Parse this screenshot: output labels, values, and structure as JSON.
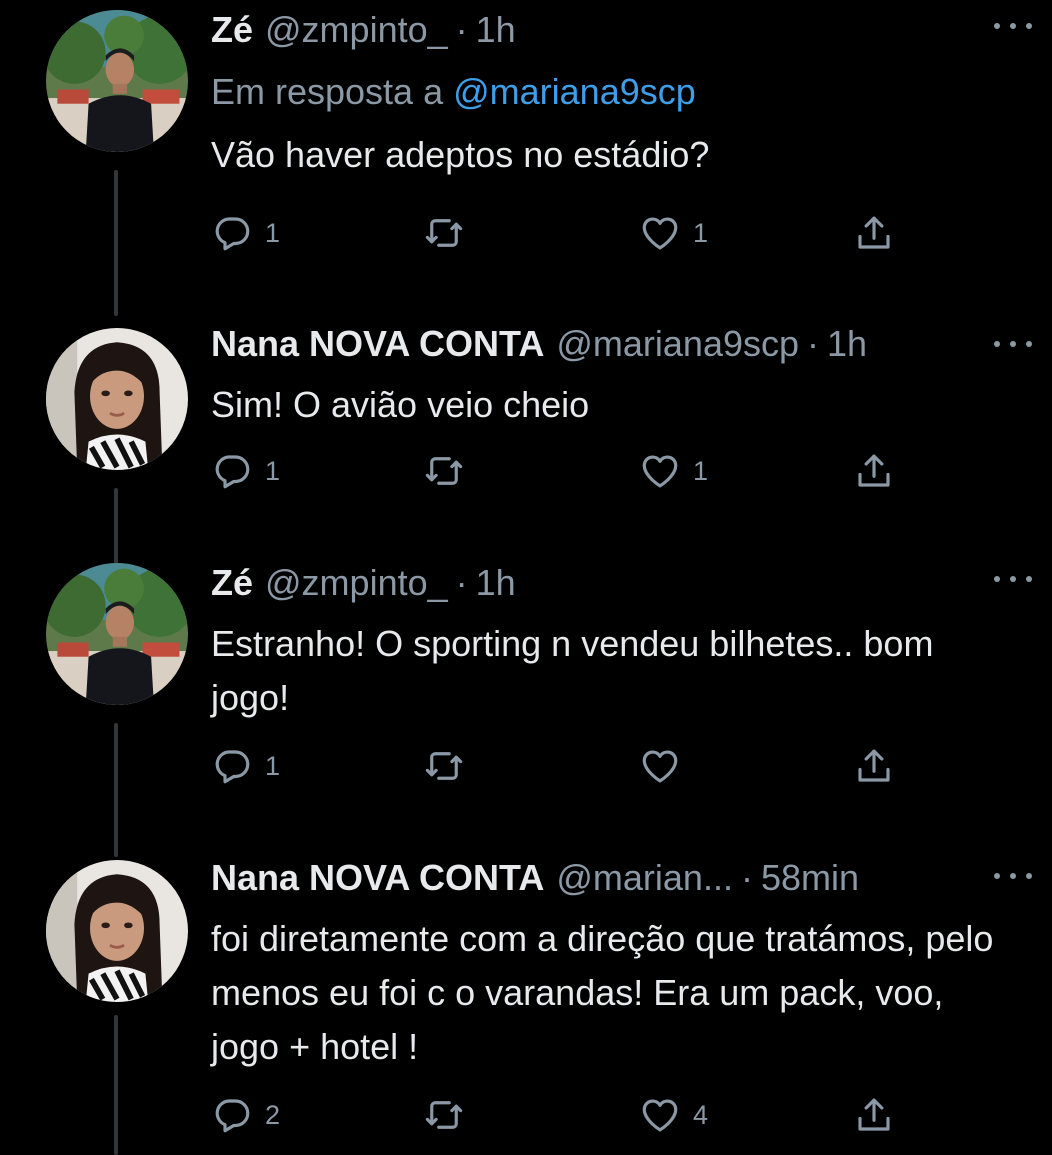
{
  "tweets": [
    {
      "name": "Zé",
      "handle": "@zmpinto_",
      "dot": "·",
      "time": "1h",
      "reply_prefix": "Em resposta a ",
      "reply_mention": "@mariana9scp",
      "text": "Vão haver adeptos no estádio?",
      "reply_count": "1",
      "retweet_count": "",
      "like_count": "1"
    },
    {
      "name": "Nana NOVA CONTA",
      "handle": "@mariana9scp",
      "dot": "·",
      "time": "1h",
      "text": "Sim! O avião veio cheio",
      "reply_count": "1",
      "retweet_count": "",
      "like_count": "1"
    },
    {
      "name": "Zé",
      "handle": "@zmpinto_",
      "dot": "·",
      "time": "1h",
      "text": "Estranho! O sporting n vendeu bilhetes.. bom jogo!",
      "reply_count": "1",
      "retweet_count": "",
      "like_count": ""
    },
    {
      "name": "Nana NOVA CONTA",
      "handle": "@marian...",
      "dot": "·",
      "time": "58min",
      "text": "foi diretamente com a direção que tratámos, pelo menos eu foi c o varandas! Era um pack, voo, jogo + hotel !",
      "reply_count": "2",
      "retweet_count": "",
      "like_count": "4"
    }
  ],
  "icons": {
    "reply": "reply-icon",
    "retweet": "retweet-icon",
    "like": "heart-icon",
    "share": "share-icon",
    "more": "more-icon"
  },
  "colors": {
    "background": "#000000",
    "text": "#e7e9ea",
    "secondary": "#8b98a5",
    "link": "#3f9ee8",
    "thread_line": "#333639"
  }
}
